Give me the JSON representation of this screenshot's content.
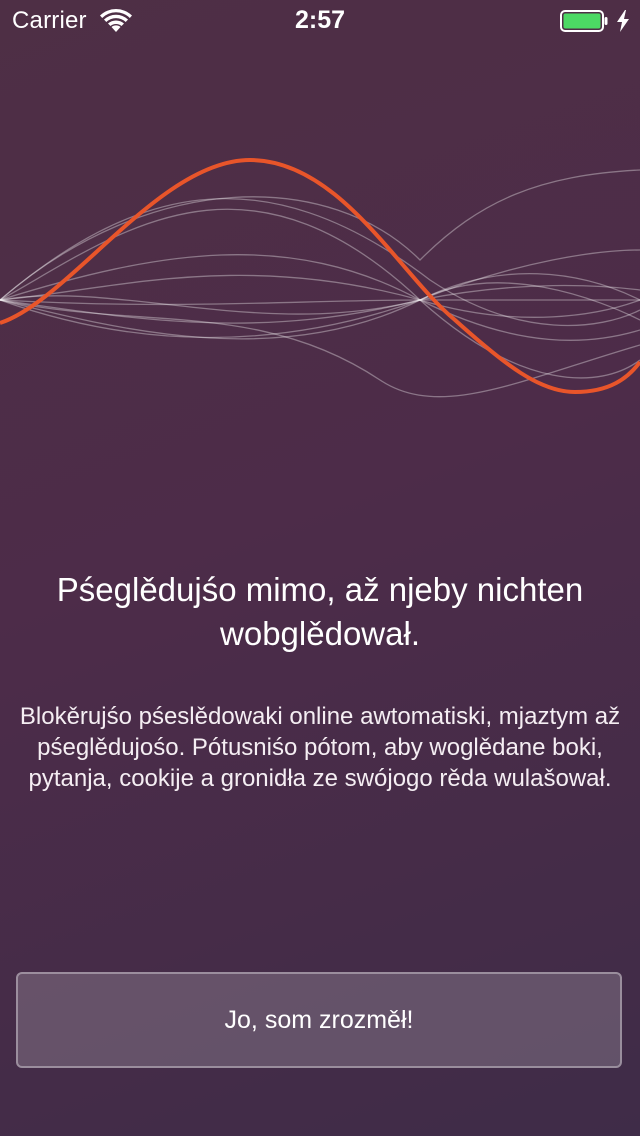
{
  "status_bar": {
    "carrier": "Carrier",
    "time": "2:57",
    "wifi_icon": "wifi-icon",
    "battery_icon": "battery-full-icon",
    "charging_icon": "bolt-icon",
    "battery_color": "#4cd964"
  },
  "illustration": {
    "icon": "sound-waves-illustration",
    "accent_color": "#e8552a"
  },
  "onboarding": {
    "headline": "Pśeglědujśo mimo, až njeby nichten wobglědował.",
    "description": "Blokěrujśo pśeslědowaki online awtomatiski, mjaztym až pśeglědujośo. Pótusniśo pótom, aby woglědane boki, pytanja, cookije a gronidła ze swójogo rěda wulašował.",
    "button_label": "Jo, som zrozměł!"
  }
}
